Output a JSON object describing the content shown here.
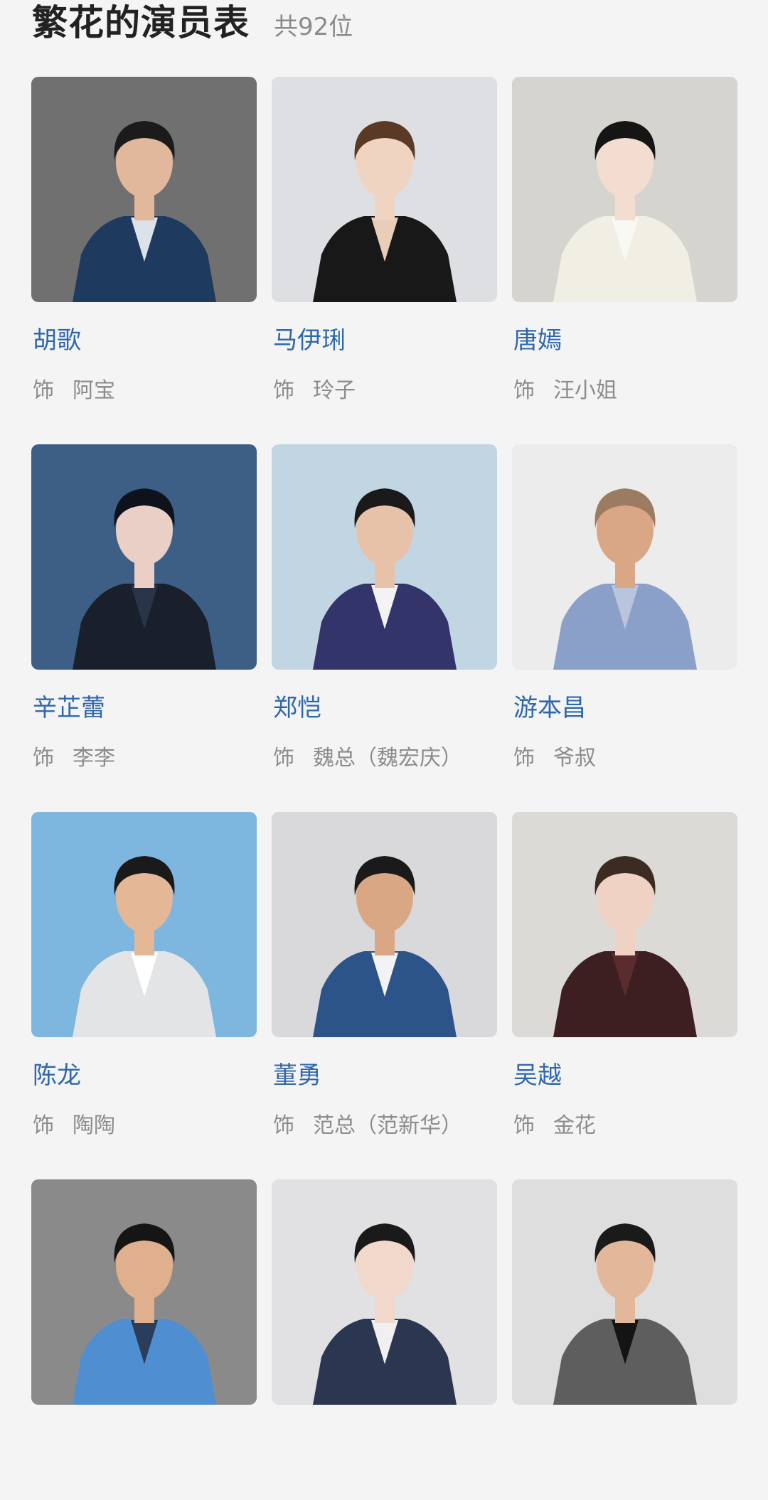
{
  "header": {
    "title": "繁花的演员表",
    "count": "共92位"
  },
  "cast": [
    {
      "name": "胡歌",
      "role_prefix": "饰",
      "role": "阿宝",
      "bg": "#707070",
      "shirt": "#1f3a5f",
      "inner": "#dbe2ea",
      "hair": "#1b1b1b",
      "skin": "#e2b89c"
    },
    {
      "name": "马伊琍",
      "role_prefix": "饰",
      "role": "玲子",
      "bg": "#dedfe3",
      "shirt": "#181818",
      "inner": "#e8cdb8",
      "hair": "#5a3a24",
      "skin": "#f0d4c2"
    },
    {
      "name": "唐嫣",
      "role_prefix": "饰",
      "role": "汪小姐",
      "bg": "#d6d4ce",
      "shirt": "#f1efe3",
      "inner": "#f8f8f5",
      "hair": "#151515",
      "skin": "#f3ddd0"
    },
    {
      "name": "辛芷蕾",
      "role_prefix": "饰",
      "role": "李李",
      "bg": "#3d5f86",
      "shirt": "#1a1f2c",
      "inner": "#2a3448",
      "hair": "#0e121c",
      "skin": "#e9cfc6"
    },
    {
      "name": "郑恺",
      "role_prefix": "饰",
      "role": "魏总（魏宏庆）",
      "bg": "#c1d6e2",
      "shirt": "#33346a",
      "inner": "#f3f3f3",
      "hair": "#1a1a1a",
      "skin": "#e8c2a8"
    },
    {
      "name": "游本昌",
      "role_prefix": "饰",
      "role": "爷叔",
      "bg": "#ececec",
      "shirt": "#8ba0c8",
      "inner": "#b9c5dd",
      "hair": "#9b7c62",
      "skin": "#d9a786"
    },
    {
      "name": "陈龙",
      "role_prefix": "饰",
      "role": "陶陶",
      "bg": "#7db7df",
      "shirt": "#e2e4e5",
      "inner": "#ffffff",
      "hair": "#1a1a1a",
      "skin": "#e4b796"
    },
    {
      "name": "董勇",
      "role_prefix": "饰",
      "role": "范总（范新华）",
      "bg": "#d9d9db",
      "shirt": "#2c5488",
      "inner": "#f3f3f3",
      "hair": "#1a1a1a",
      "skin": "#d9a784"
    },
    {
      "name": "吴越",
      "role_prefix": "饰",
      "role": "金花",
      "bg": "#dcdad6",
      "shirt": "#3d1f22",
      "inner": "#5a2b2f",
      "hair": "#3b2b22",
      "skin": "#efd2c3"
    },
    {
      "name": "",
      "role_prefix": "",
      "role": "",
      "bg": "#8a8a8a",
      "shirt": "#4f8fd1",
      "inner": "#2a3d5c",
      "hair": "#151515",
      "skin": "#e0b08e"
    },
    {
      "name": "",
      "role_prefix": "",
      "role": "",
      "bg": "#e1e1e3",
      "shirt": "#2b3650",
      "inner": "#f0f0f0",
      "hair": "#1a1a1a",
      "skin": "#f2d8cb"
    },
    {
      "name": "",
      "role_prefix": "",
      "role": "",
      "bg": "#dedede",
      "shirt": "#5e5e5e",
      "inner": "#141414",
      "hair": "#1a1a1a",
      "skin": "#e3b89a"
    }
  ]
}
